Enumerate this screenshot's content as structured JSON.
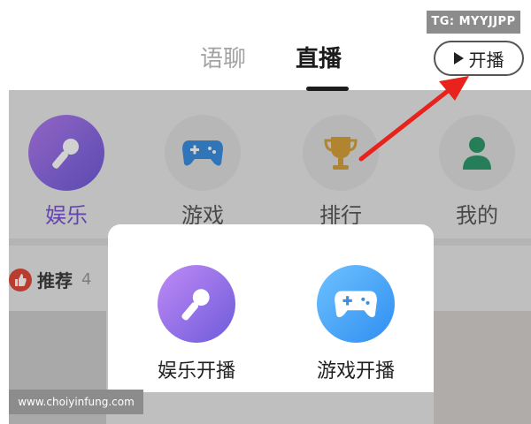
{
  "watermarks": {
    "tg": "TG: MYYJJPP",
    "url": "www.choiyinfung.com"
  },
  "top_nav": {
    "tabs": [
      {
        "label": "语聊"
      },
      {
        "label": "直播"
      }
    ],
    "active_tab": "直播",
    "start_live_label": "开播"
  },
  "categories": [
    {
      "label": "娱乐",
      "icon": "microphone-icon"
    },
    {
      "label": "游戏",
      "icon": "gamepad-icon"
    },
    {
      "label": "排行",
      "icon": "trophy-icon"
    },
    {
      "label": "我的",
      "icon": "user-icon"
    }
  ],
  "recommend": {
    "label": "推荐",
    "count_fragment": "4"
  },
  "popup": {
    "options": [
      {
        "label": "娱乐开播",
        "icon": "microphone-icon"
      },
      {
        "label": "游戏开播",
        "icon": "gamepad-icon"
      }
    ]
  },
  "annotation": {
    "arrow_color": "#e8231d"
  },
  "colors": {
    "accent_purple": "#7b54d6",
    "game_blue": "#2f8ef0"
  }
}
